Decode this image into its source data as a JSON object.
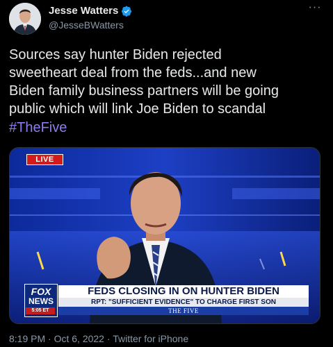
{
  "author": {
    "name": "Jesse Watters",
    "handle": "@JesseBWatters",
    "verified": true
  },
  "more_icon": "more-horizontal-icon",
  "tweet": {
    "text": "Sources say hunter Biden rejected\nsweetheart deal from the feds...and new\nBiden family business partners will be going\npublic which will link Joe Biden to scandal",
    "hashtag": "#TheFive"
  },
  "media": {
    "live_badge": "LIVE",
    "network_logo_top": "FOX",
    "network_logo_bottom": "NEWS",
    "logo_time": "5:05 ET",
    "chyron_headline": "FEDS CLOSING IN ON HUNTER BIDEN",
    "chyron_subhead": "RPT: \"SUFFICIENT EVIDENCE\" TO CHARGE FIRST SON",
    "show_name": "THE FIVE"
  },
  "footer": {
    "time": "8:19 PM",
    "separator": "·",
    "date": "Oct 6, 2022",
    "source": "Twitter for iPhone"
  },
  "colors": {
    "background": "#000000",
    "text_primary": "#e7e9ea",
    "text_secondary": "#8b98a5",
    "hashtag": "#8e7cf0",
    "verified_badge": "#1d9bf0",
    "live_red": "#d31b1b",
    "fox_blue": "#0d2a7a"
  }
}
